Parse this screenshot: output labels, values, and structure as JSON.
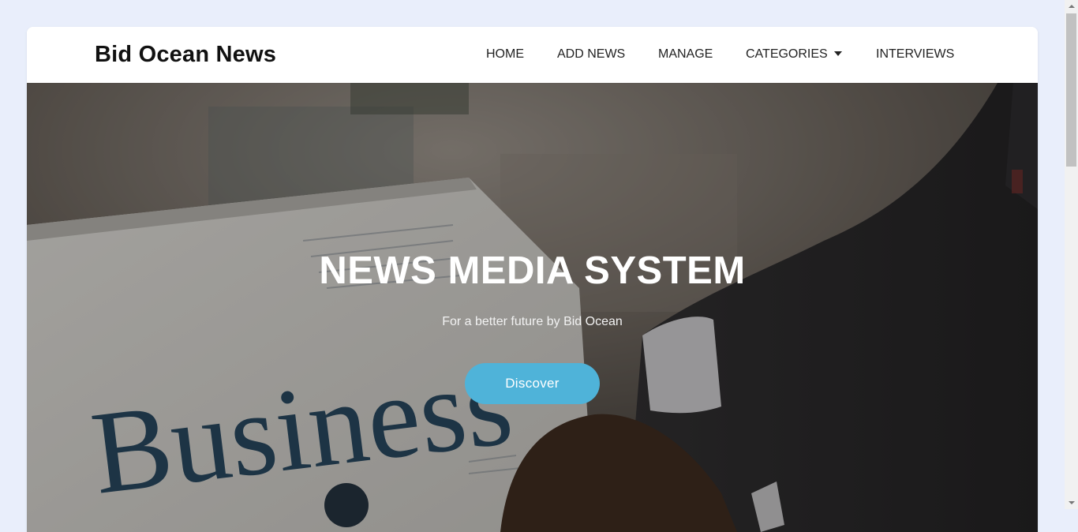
{
  "brand": {
    "name": "Bid Ocean News"
  },
  "nav": {
    "items": [
      {
        "label": "HOME"
      },
      {
        "label": "ADD NEWS"
      },
      {
        "label": "MANAGE"
      },
      {
        "label": "CATEGORIES"
      },
      {
        "label": "INTERVIEWS"
      }
    ]
  },
  "hero": {
    "title": "NEWS MEDIA SYSTEM",
    "subtitle": "For a better future by Bid Ocean",
    "cta_label": "Discover",
    "newspaper_headline": "Business"
  },
  "colors": {
    "page_bg": "#e9eefb",
    "accent": "#4fb3d9"
  }
}
